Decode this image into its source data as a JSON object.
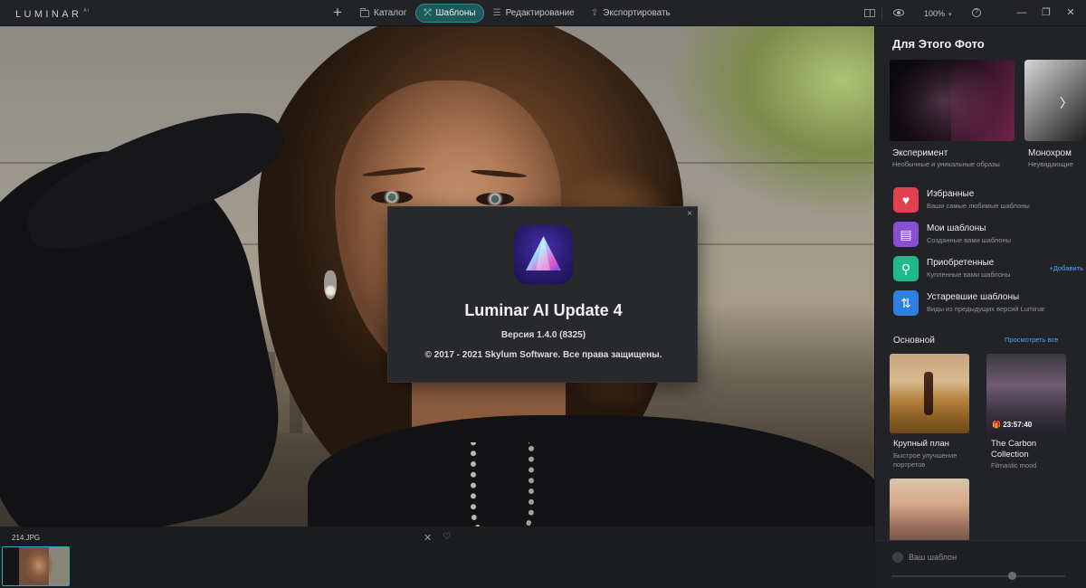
{
  "app": {
    "logo": "LUMINAR",
    "logo_sup": "AI"
  },
  "nav": {
    "add": "+",
    "catalog": "Каталог",
    "templates": "Шаблоны",
    "edit": "Редактирование",
    "export": "Экспортировать"
  },
  "toolbar": {
    "zoom": "100%"
  },
  "window": {
    "minimize": "—",
    "restore": "❐",
    "close": "✕"
  },
  "dialog": {
    "close": "×",
    "title": "Luminar AI Update 4",
    "version": "Версия 1.4.0 (8325)",
    "copyright": "© 2017 - 2021 Skylum Software. Все права защищены."
  },
  "filmstrip": {
    "filename": "214.JPG"
  },
  "panel": {
    "title": "Для Этого Фото",
    "featured": [
      {
        "name": "Эксперимент",
        "sub": "Необычные и уникальные образы"
      },
      {
        "name": "Монохром",
        "sub": "Неувядающие"
      }
    ],
    "collections": [
      {
        "name": "Избранные",
        "sub": "Ваши самые любимые шаблоны",
        "icon": "heart-icon",
        "color": "#e0404f"
      },
      {
        "name": "Мои шаблоны",
        "sub": "Созданные вами шаблоны",
        "icon": "my-templates-icon",
        "color": "#8a4fd1"
      },
      {
        "name": "Приобретенные",
        "sub": "Купленные вами шаблоны",
        "icon": "purchased-icon",
        "color": "#1fb98a",
        "action": "+Добавить"
      },
      {
        "name": "Устаревшие шаблоны",
        "sub": "Виды из предыдущих версий Luminar",
        "icon": "legacy-icon",
        "color": "#2f7ee0"
      }
    ],
    "section": {
      "title": "Основной",
      "see_all": "Просмотреть все"
    },
    "templates": [
      {
        "name": "Крупный план",
        "sub": "Быстрое улучшение портретов"
      },
      {
        "name": "The Carbon Collection",
        "sub": "Filmastic mood",
        "badge": "23:57:40"
      }
    ],
    "save_template": "Ваш шаблон"
  },
  "colors": {
    "accent": "#2d8d8a",
    "link": "#4aa8ff",
    "panel_bg": "#222326"
  }
}
